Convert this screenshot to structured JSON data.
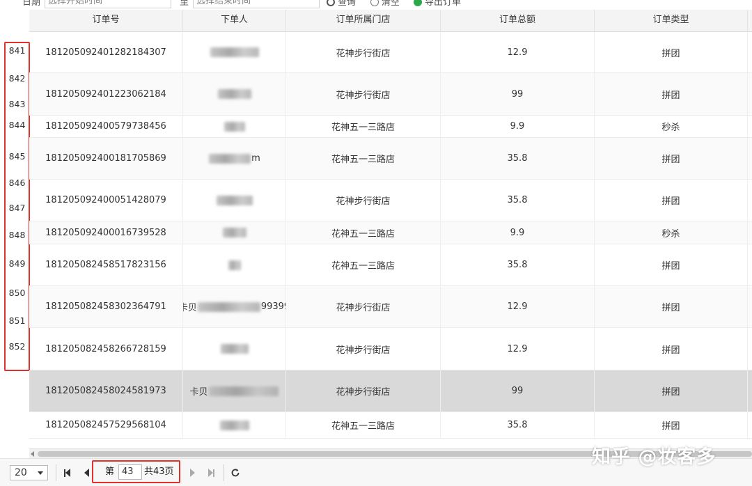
{
  "toolbar": {
    "date_label": "日期",
    "start_placeholder": "选择开始时间",
    "to_label": "至",
    "end_placeholder": "选择结束时间",
    "search_label": "查询",
    "clear_label": "清空",
    "export_label": "导出订单"
  },
  "table": {
    "columns": [
      "订单号",
      "下单人",
      "订单所属门店",
      "订单总额",
      "订单类型"
    ],
    "row_numbers": [
      "841",
      "842",
      "843",
      "844",
      "845",
      "846",
      "847",
      "848",
      "849",
      "850",
      "851",
      "852"
    ],
    "rows": [
      {
        "order_no": "181205092401282184307",
        "customer_prefix": "",
        "customer_suffix": "",
        "store": "花神步行街店",
        "total": "12.9",
        "type": "拼团"
      },
      {
        "order_no": "181205092401223062184",
        "customer_prefix": "",
        "customer_suffix": "",
        "store": "花神步行街店",
        "total": "99",
        "type": "拼团"
      },
      {
        "order_no": "181205092400579738456",
        "customer_prefix": "",
        "customer_suffix": "",
        "store": "花神五一三路店",
        "total": "9.9",
        "type": "秒杀"
      },
      {
        "order_no": "181205092400181705869",
        "customer_prefix": "",
        "customer_suffix": "m",
        "store": "花神五一三路店",
        "total": "35.8",
        "type": "拼团"
      },
      {
        "order_no": "181205092400051428079",
        "customer_prefix": "",
        "customer_suffix": "",
        "store": "花神步行街店",
        "total": "35.8",
        "type": "拼团"
      },
      {
        "order_no": "181205092400016739528",
        "customer_prefix": "",
        "customer_suffix": "",
        "store": "花神五一三路店",
        "total": "9.9",
        "type": "秒杀"
      },
      {
        "order_no": "181205082458517823156",
        "customer_prefix": "",
        "customer_suffix": "",
        "store": "花神五一三路店",
        "total": "35.8",
        "type": "拼团"
      },
      {
        "order_no": "181205082458302364791",
        "customer_prefix": "卡贝",
        "customer_suffix": "99399",
        "store": "花神步行街店",
        "total": "12.9",
        "type": "拼团"
      },
      {
        "order_no": "181205082458266728159",
        "customer_prefix": "",
        "customer_suffix": "",
        "store": "花神步行街店",
        "total": "12.9",
        "type": "拼团"
      },
      {
        "order_no": "181205082458024581973",
        "customer_prefix": "卡贝",
        "customer_suffix": "",
        "store": "花神步行街店",
        "total": "99",
        "type": "拼团"
      },
      {
        "order_no": "181205082457529568104",
        "customer_prefix": "",
        "customer_suffix": "",
        "store": "花神五一三路店",
        "total": "35.8",
        "type": "拼团"
      }
    ]
  },
  "pager": {
    "page_size": "20",
    "page_prefix": "第",
    "current_page": "43",
    "total_pages_text": "共43页"
  },
  "watermark": "知乎 @妆客多",
  "colors": {
    "highlight_border": "#e0322c",
    "export_icon": "#2aa84a"
  }
}
